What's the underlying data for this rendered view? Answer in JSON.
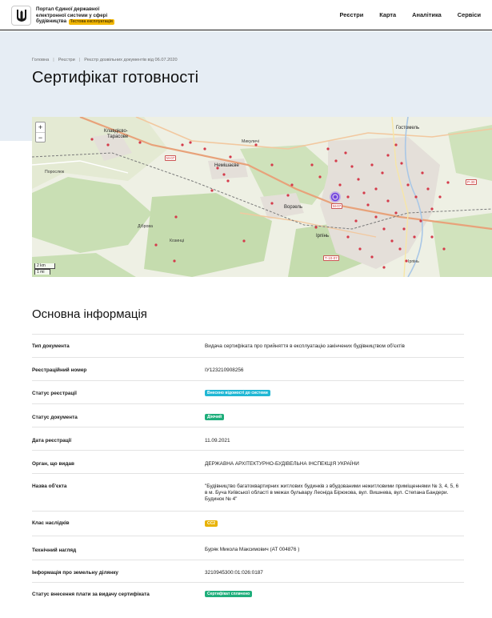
{
  "header": {
    "brand_line1": "Портал Єдиної державної",
    "brand_line2": "електронної системи у сфері",
    "brand_line3": "будівництва",
    "brand_badge": "Тестова експлуатація",
    "nav": [
      "Реєстри",
      "Карта",
      "Аналітика",
      "Сервіси"
    ]
  },
  "breadcrumb": [
    "Головна",
    "Реєстри",
    "Реєстр дозвільних документів від 06.07.2020"
  ],
  "page_title": "Сертифікат готовності",
  "map": {
    "zoom_in": "+",
    "zoom_out": "−",
    "scale_km": "2 km",
    "scale_mi": "1 mi",
    "labels": {
      "klavdievo": "Клавдієво-",
      "klavdievo2": "Тарасове",
      "nemishaieve": "Немішаєве",
      "mykulychi": "Микуличі",
      "hostomel": "Гостомель",
      "vorzel": "Ворзель",
      "irpin": "Ірпінь",
      "irpin_top": "Ірпінь",
      "dubova": "Діброва",
      "kozyntsi": "Козинці",
      "porosiuchka": "Порослюк",
      "road_m07": "М-07",
      "road_t1007": "Т-10-07",
      "road_m07b": "М-07",
      "road_r": "Р-30"
    }
  },
  "section_title": "Основна інформація",
  "rows": [
    {
      "label": "Тип документа",
      "value": "Видача сертифіката про прийняття в експлуатацію закінчених будівництвом об'єктів"
    },
    {
      "label": "Реєстраційний номер",
      "value": "IУ123210908256"
    },
    {
      "label": "Статус реєстрації",
      "badge": "Внесено відомості до системи",
      "badge_color": "#20b7d4"
    },
    {
      "label": "Статус документа",
      "badge": "Діючий",
      "badge_color": "#1fae7b"
    },
    {
      "label": "Дата реєстрації",
      "value": "11.09.2021"
    },
    {
      "label": "Орган, що видав",
      "value": "ДЕРЖАВНА АРХІТЕКТУРНО-БУДІВЕЛЬНА ІНСПЕКЦІЯ УКРАЇНИ"
    },
    {
      "label": "Назва об'єкта",
      "value": "\"Будівництво багатоквартирних житлових будинків з вбудованими нежитловими приміщеннями № 3, 4, 5, 6 в м. Буча Київської області в межах бульвару Леоніда Бірюкова, вул. Вишнева, вул. Степана Бандери. Будинок № 4\""
    },
    {
      "label": "Клас наслідків",
      "badge": "СС2",
      "badge_color": "#e8b200"
    },
    {
      "label": "Технічний нагляд",
      "value": "Буряк Микола Максимович (АТ 004876 )"
    },
    {
      "label": "Інформація про земельну ділянку",
      "value": "3210945300:01:026:0187"
    },
    {
      "label": "Статус внесення плати за видачу сертифіката",
      "badge": "Сертифікат сплачено",
      "badge_color": "#1fae7b"
    }
  ]
}
